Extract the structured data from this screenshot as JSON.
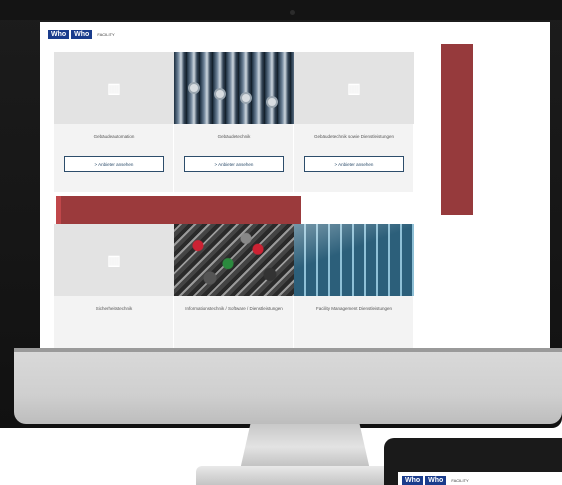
{
  "logo": {
    "part1": "Who",
    "part2": "Who",
    "tag": "FACILITY"
  },
  "cards": [
    {
      "title": "Gebäudeautomation",
      "button": "> Anbieter ansehen",
      "image": "building-icon"
    },
    {
      "title": "Gebäudetechnik",
      "button": "> Anbieter ansehen",
      "image": "pipes-photo"
    },
    {
      "title": "Gebäudetechnik sowie Dienstleistungen",
      "button": "> Anbieter ansehen",
      "image": "building-icon"
    },
    {
      "title": "Sicherheitstechnik",
      "button": "",
      "image": "building-icon"
    },
    {
      "title": "Informationstechnik / Software / Dienstleistungen",
      "button": "",
      "image": "cables-photo"
    },
    {
      "title": "Facility Management Dienstleistungen",
      "button": "",
      "image": "glass-photo"
    }
  ],
  "tablet_logo": {
    "part1": "Who",
    "part2": "Who",
    "tag": "FACILITY"
  },
  "colors": {
    "brand_blue": "#1a3c8c",
    "accent_red": "#9b3a3c",
    "button_border": "#2d4d6b"
  }
}
